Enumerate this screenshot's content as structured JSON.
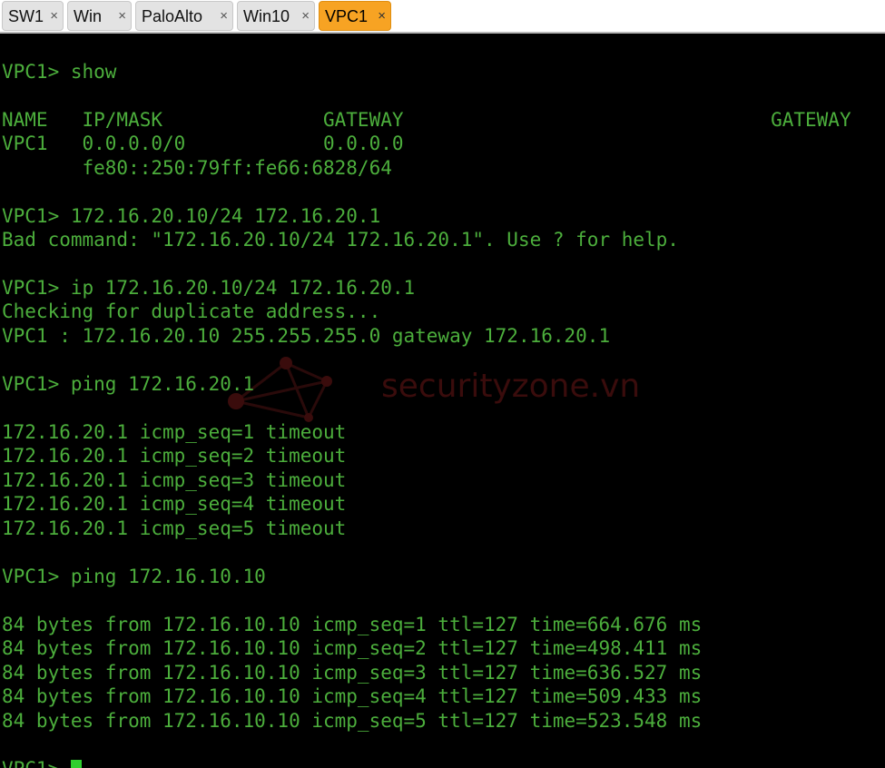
{
  "tabs": [
    {
      "label": "SW1",
      "close": "×",
      "active": false
    },
    {
      "label": "Win",
      "close": "×",
      "active": false
    },
    {
      "label": "PaloAlto",
      "close": "×",
      "active": false
    },
    {
      "label": "Win10",
      "close": "×",
      "active": false
    },
    {
      "label": "VPC1",
      "close": "×",
      "active": true
    }
  ],
  "colors": {
    "terminal_text": "#4cae3c",
    "terminal_bg": "#000000",
    "active_tab": "#f7a323",
    "cursor": "#2fcf2f"
  },
  "watermark": {
    "text": "securityzone.vn",
    "icon": "network-graph-icon"
  },
  "terminal": {
    "lines": [
      "VPC1> show",
      "NAME   IP/MASK              GATEWAY                                GATEWAY",
      "VPC1   0.0.0.0/0            0.0.0.0",
      "       fe80::250:79ff:fe66:6828/64",
      "VPC1> 172.16.20.10/24 172.16.20.1",
      "Bad command: \"172.16.20.10/24 172.16.20.1\". Use ? for help.",
      "VPC1> ip 172.16.20.10/24 172.16.20.1",
      "Checking for duplicate address...",
      "VPC1 : 172.16.20.10 255.255.255.0 gateway 172.16.20.1",
      "VPC1> ping 172.16.20.1",
      "172.16.20.1 icmp_seq=1 timeout",
      "172.16.20.1 icmp_seq=2 timeout",
      "172.16.20.1 icmp_seq=3 timeout",
      "172.16.20.1 icmp_seq=4 timeout",
      "172.16.20.1 icmp_seq=5 timeout",
      "VPC1> ping 172.16.10.10",
      "84 bytes from 172.16.10.10 icmp_seq=1 ttl=127 time=664.676 ms",
      "84 bytes from 172.16.10.10 icmp_seq=2 ttl=127 time=498.411 ms",
      "84 bytes from 172.16.10.10 icmp_seq=3 ttl=127 time=636.527 ms",
      "84 bytes from 172.16.10.10 icmp_seq=4 ttl=127 time=509.433 ms",
      "84 bytes from 172.16.10.10 icmp_seq=5 ttl=127 time=523.548 ms",
      "VPC1> "
    ]
  }
}
